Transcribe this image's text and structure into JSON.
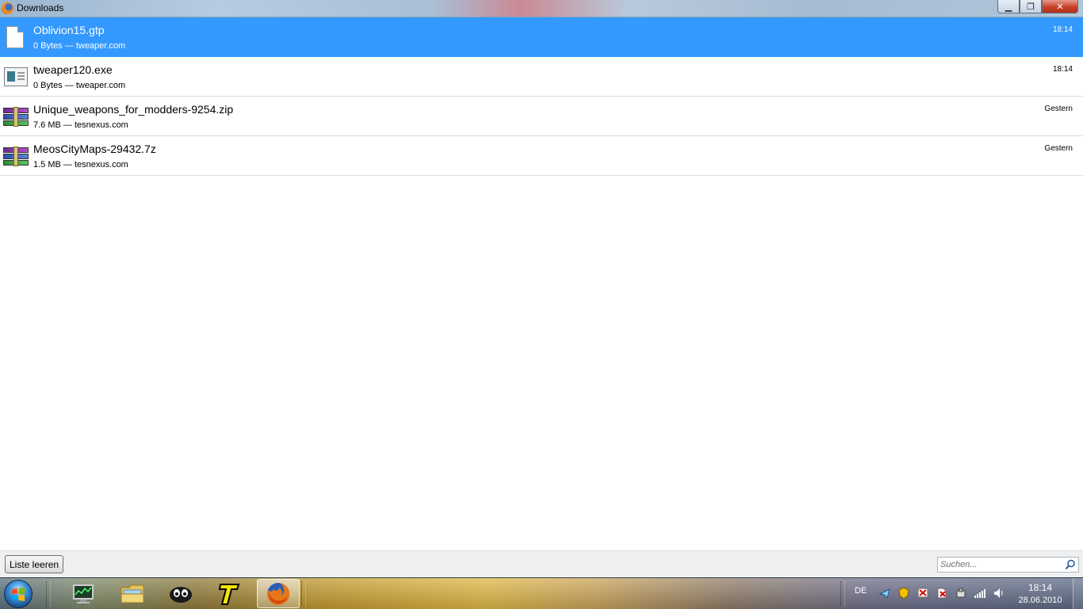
{
  "window": {
    "title": "Downloads",
    "buttons": {
      "minimize": "▁",
      "maximize": "❐",
      "close": "✕"
    }
  },
  "downloads": [
    {
      "name": "Oblivion15.gtp",
      "size": "0 Bytes",
      "source": "tweaper.com",
      "time": "18:14",
      "icon": "generic-file-icon",
      "selected": true
    },
    {
      "name": "tweaper120.exe",
      "size": "0 Bytes",
      "source": "tweaper.com",
      "time": "18:14",
      "icon": "exe-file-icon",
      "selected": false
    },
    {
      "name": "Unique_weapons_for_modders-9254.zip",
      "size": "7.6 MB",
      "source": "tesnexus.com",
      "time": "Gestern",
      "icon": "archive-icon",
      "selected": false
    },
    {
      "name": "MeosCityMaps-29432.7z",
      "size": "1.5 MB",
      "source": "tesnexus.com",
      "time": "Gestern",
      "icon": "archive-icon",
      "selected": false
    }
  ],
  "meta_separator": " — ",
  "toolbar": {
    "clear_label": "Liste leeren",
    "search_placeholder": "Suchen..."
  },
  "taskbar": {
    "language": "DE",
    "time": "18:14",
    "date": "28.06.2010"
  },
  "colors": {
    "selection": "#3399ff",
    "row_divider": "#dcdcdc"
  }
}
